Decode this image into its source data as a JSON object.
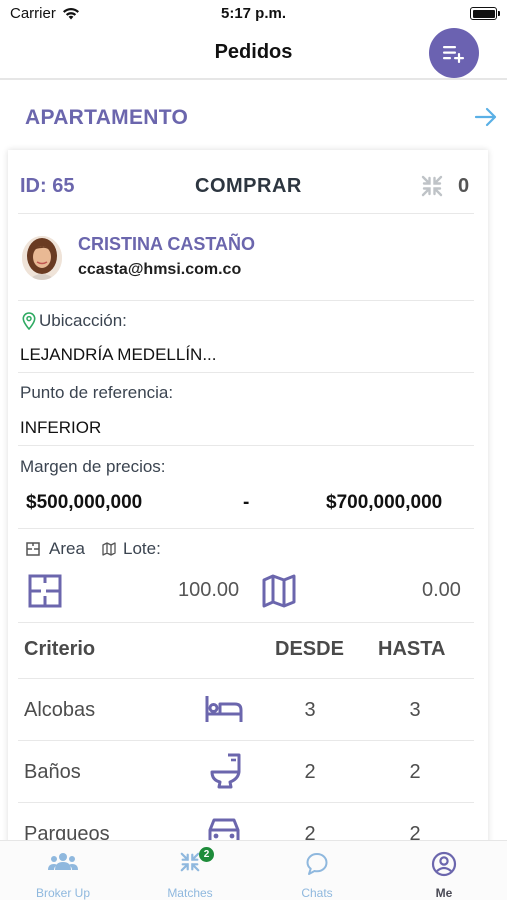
{
  "status": {
    "carrier": "Carrier",
    "time": "5:17 p.m."
  },
  "nav": {
    "title": "Pedidos"
  },
  "section": {
    "title": "APARTAMENTO"
  },
  "card": {
    "id_label": "ID: 65",
    "action": "COMPRAR",
    "match_count": "0",
    "agent": {
      "name": "CRISTINA CASTAÑO",
      "email": "ccasta@hmsi.com.co"
    },
    "location_label": "Ubicacción:",
    "location_value": "LEJANDRÍA  MEDELLÍN...",
    "reference_label": "Punto de referencia:",
    "reference_value": "INFERIOR",
    "price_label": "Margen de precios:",
    "price_min": "$500,000,000",
    "price_sep": "-",
    "price_max": "$700,000,000",
    "area_label": "Area",
    "lote_label": "Lote:",
    "area_value": "100.00",
    "lote_value": "0.00",
    "criteria": {
      "headers": {
        "criterio": "Criterio",
        "desde": "DESDE",
        "hasta": "HASTA"
      },
      "rows": [
        {
          "name": "Alcobas",
          "icon": "bed-icon",
          "desde": "3",
          "hasta": "3"
        },
        {
          "name": "Baños",
          "icon": "toilet-icon",
          "desde": "2",
          "hasta": "2"
        },
        {
          "name": "Parqueos",
          "icon": "car-icon",
          "desde": "2",
          "hasta": "2"
        }
      ]
    }
  },
  "tabs": [
    {
      "label": "Broker Up",
      "icon": "users-icon"
    },
    {
      "label": "Matches",
      "icon": "matches-icon",
      "badge": "2"
    },
    {
      "label": "Chats",
      "icon": "chat-icon"
    },
    {
      "label": "Me",
      "icon": "user-circle-icon"
    }
  ],
  "colors": {
    "accent": "#6b66ad",
    "fab": "#6b62b1",
    "tab_inactive": "#8fb8de",
    "badge": "#1e8c3a"
  }
}
